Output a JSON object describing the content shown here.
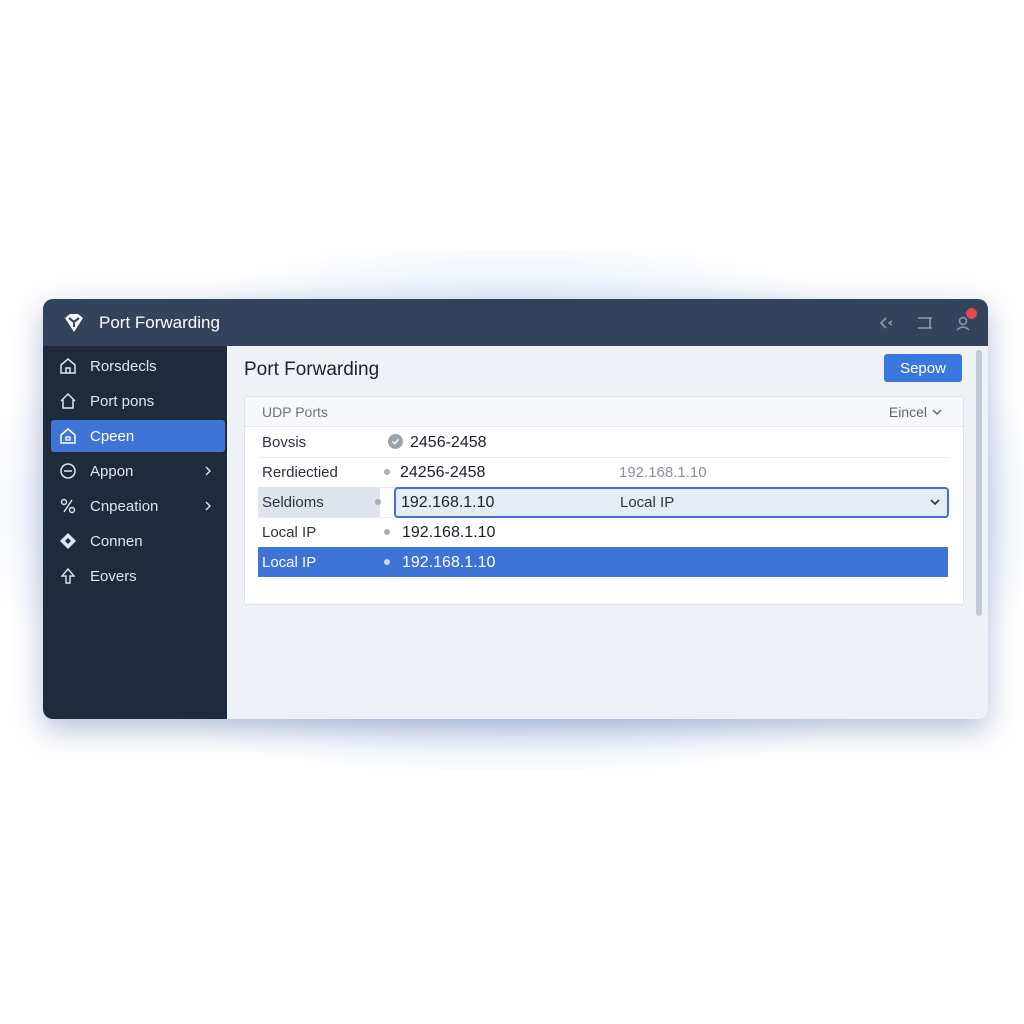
{
  "window": {
    "title": "Port Forwarding"
  },
  "colors": {
    "titlebar": "#33435c",
    "sidebar": "#1f2a3d",
    "accent": "#3b78dd",
    "notification": "#e5484d"
  },
  "titlebar_icons": [
    "back-icon",
    "window-icon",
    "user-icon"
  ],
  "sidebar": {
    "items": [
      {
        "label": "Rorsdecls",
        "icon": "home-icon",
        "active": false,
        "chevron": false
      },
      {
        "label": "Port pons",
        "icon": "house-outline-icon",
        "active": false,
        "chevron": false
      },
      {
        "label": "Cpeen",
        "icon": "home-square-icon",
        "active": true,
        "chevron": false
      },
      {
        "label": "Appon",
        "icon": "smile-circle-icon",
        "active": false,
        "chevron": true
      },
      {
        "label": "Cnpeation",
        "icon": "connection-icon",
        "active": false,
        "chevron": true
      },
      {
        "label": "Connen",
        "icon": "diamond-icon",
        "active": false,
        "chevron": false
      },
      {
        "label": "Eovers",
        "icon": "upload-arrow-icon",
        "active": false,
        "chevron": false
      }
    ]
  },
  "main": {
    "title": "Port Forwarding",
    "primary_button": "Sepow",
    "panel": {
      "header_label": "UDP Ports",
      "header_select": "Eincel",
      "rows": [
        {
          "label": "Bovsis",
          "value": "2456-2458",
          "extra": "",
          "style": "check"
        },
        {
          "label": "Rerdiectied",
          "value": "24256-2458",
          "extra": "192.168.1.10",
          "style": "normal"
        },
        {
          "label": "Seldioms",
          "value": "192.168.1.10",
          "extra": "Local IP",
          "style": "editing"
        },
        {
          "label": "Local IP",
          "value": "192.168.1.10",
          "extra": "",
          "style": "normal"
        },
        {
          "label": "Local IP",
          "value": "192.168.1.10",
          "extra": "",
          "style": "highlight"
        }
      ]
    }
  }
}
